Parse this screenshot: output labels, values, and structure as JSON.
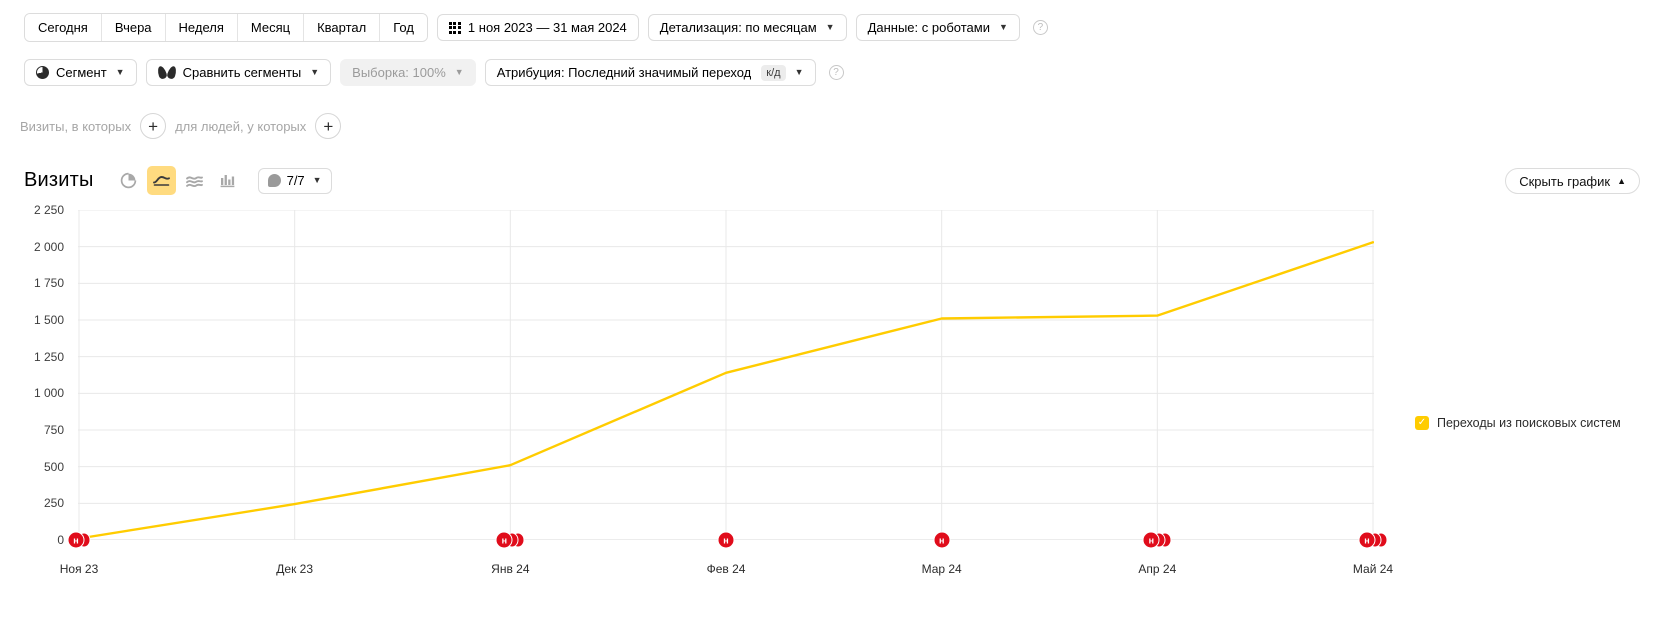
{
  "toolbar": {
    "period_buttons": [
      "Сегодня",
      "Вчера",
      "Неделя",
      "Месяц",
      "Квартал",
      "Год"
    ],
    "date_range": "1 ноя 2023 — 31 мая 2024",
    "detail": "Детализация: по месяцам",
    "data_robots": "Данные: с роботами",
    "help": "?"
  },
  "filters_bar": {
    "segment": "Сегмент",
    "compare_segments": "Сравнить сегменты",
    "sampling": "Выборка: 100%",
    "attribution": "Атрибуция: Последний значимый переход",
    "attribution_badge": "к/д",
    "help": "?"
  },
  "conditions": {
    "visits_label": "Визиты, в которых",
    "people_label": "для людей, у которых",
    "add": "+"
  },
  "chart_header": {
    "title": "Визиты",
    "view_buttons": [
      {
        "name": "pie-chart-view",
        "active": false
      },
      {
        "name": "line-chart-view",
        "active": true
      },
      {
        "name": "area-chart-view",
        "active": false
      },
      {
        "name": "bar-chart-view",
        "active": false
      }
    ],
    "goals_label": "7/7",
    "hide_chart": "Скрыть график"
  },
  "legend": {
    "items": [
      {
        "label": "Переходы из поисковых систем",
        "color": "#ffcc00",
        "checked": true
      }
    ]
  },
  "annotations": [
    {
      "x_index": 0,
      "count": 2,
      "letter": "н"
    },
    {
      "x_index": 2,
      "count": 3,
      "letter": "н"
    },
    {
      "x_index": 3,
      "count": 1,
      "letter": "н"
    },
    {
      "x_index": 4,
      "count": 1,
      "letter": "н"
    },
    {
      "x_index": 5,
      "count": 3,
      "letter": "н"
    },
    {
      "x_index": 6,
      "count": 3,
      "letter": "н"
    }
  ],
  "chart_data": {
    "type": "line",
    "title": "Визиты",
    "xlabel": "",
    "ylabel": "",
    "categories": [
      "Ноя 23",
      "Дек 23",
      "Янв 24",
      "Фев 24",
      "Мар 24",
      "Апр 24",
      "Май 24"
    ],
    "series": [
      {
        "name": "Переходы из поисковых систем",
        "color": "#ffcc00",
        "values": [
          10,
          245,
          510,
          1140,
          1510,
          1530,
          2030
        ]
      }
    ],
    "ylim": [
      0,
      2250
    ],
    "yticks": [
      0,
      250,
      500,
      750,
      1000,
      1250,
      1500,
      1750,
      2000,
      2250
    ],
    "ytick_labels": [
      "0",
      "250",
      "500",
      "750",
      "1 000",
      "1 250",
      "1 500",
      "1 750",
      "2 000",
      "2 250"
    ],
    "grid": true,
    "legend_position": "right"
  }
}
